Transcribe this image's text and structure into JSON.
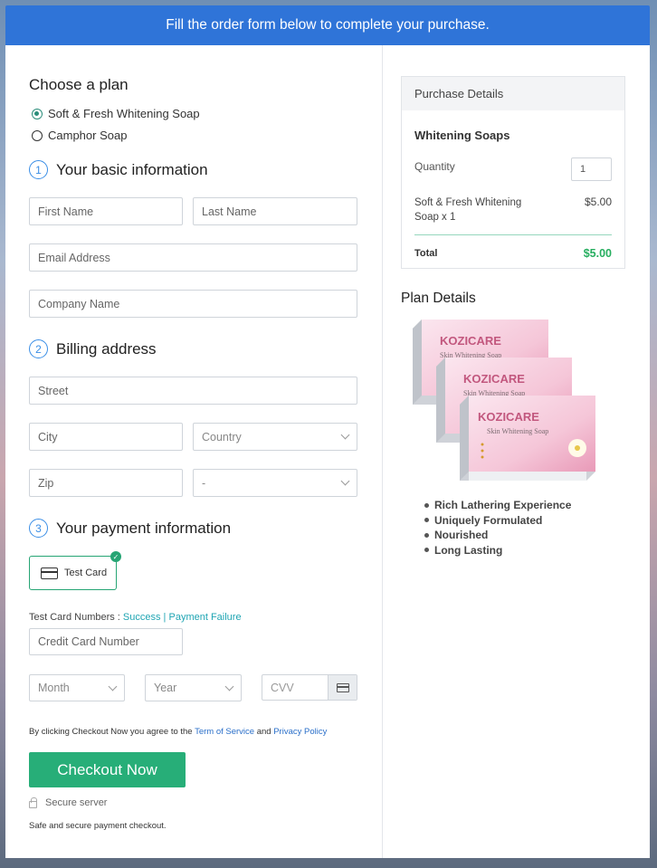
{
  "banner": "Fill the order form below to complete your purchase.",
  "plan": {
    "title": "Choose a plan",
    "options": [
      "Soft & Fresh Whitening Soap",
      "Camphor Soap"
    ],
    "selected_index": 0
  },
  "steps": [
    {
      "num": "1",
      "title": "Your basic information"
    },
    {
      "num": "2",
      "title": "Billing address"
    },
    {
      "num": "3",
      "title": "Your payment information"
    }
  ],
  "basic": {
    "first_name": "First Name",
    "last_name": "Last Name",
    "email": "Email Address",
    "company": "Company Name"
  },
  "billing": {
    "street": "Street",
    "city": "City",
    "country": "Country",
    "zip": "Zip",
    "state": "-"
  },
  "payment": {
    "card_label": "Test Card",
    "test_numbers_label": "Test Card Numbers : ",
    "success": "Success",
    "sep": " | ",
    "failure": "Payment Failure",
    "card_number": "Credit Card Number",
    "month": "Month",
    "year": "Year",
    "cvv": "CVV"
  },
  "agree": {
    "prefix": "By clicking Checkout Now you agree to the ",
    "terms": "Term of Service",
    "and": " and ",
    "privacy": "Privacy Policy"
  },
  "checkout_button": "Checkout Now",
  "secure_server": "Secure server",
  "safe_text": "Safe and secure payment checkout.",
  "purchase": {
    "header": "Purchase Details",
    "product": "Whitening Soaps",
    "quantity_label": "Quantity",
    "quantity": "1",
    "item": "Soft & Fresh Whitening Soap x 1",
    "item_price": "$5.00",
    "total_label": "Total",
    "total": "$5.00"
  },
  "plan_details": {
    "title": "Plan Details",
    "brand": "KOZICARE",
    "subtitle": "Skin Whitening Soap",
    "features": [
      "Rich Lathering Experience",
      "Uniquely Formulated",
      "Nourished",
      "Long Lasting"
    ]
  },
  "colors": {
    "banner": "#2f74d8",
    "accent_green": "#27ae78",
    "step_blue": "#3a8ee6",
    "link": "#1fa5b3"
  }
}
